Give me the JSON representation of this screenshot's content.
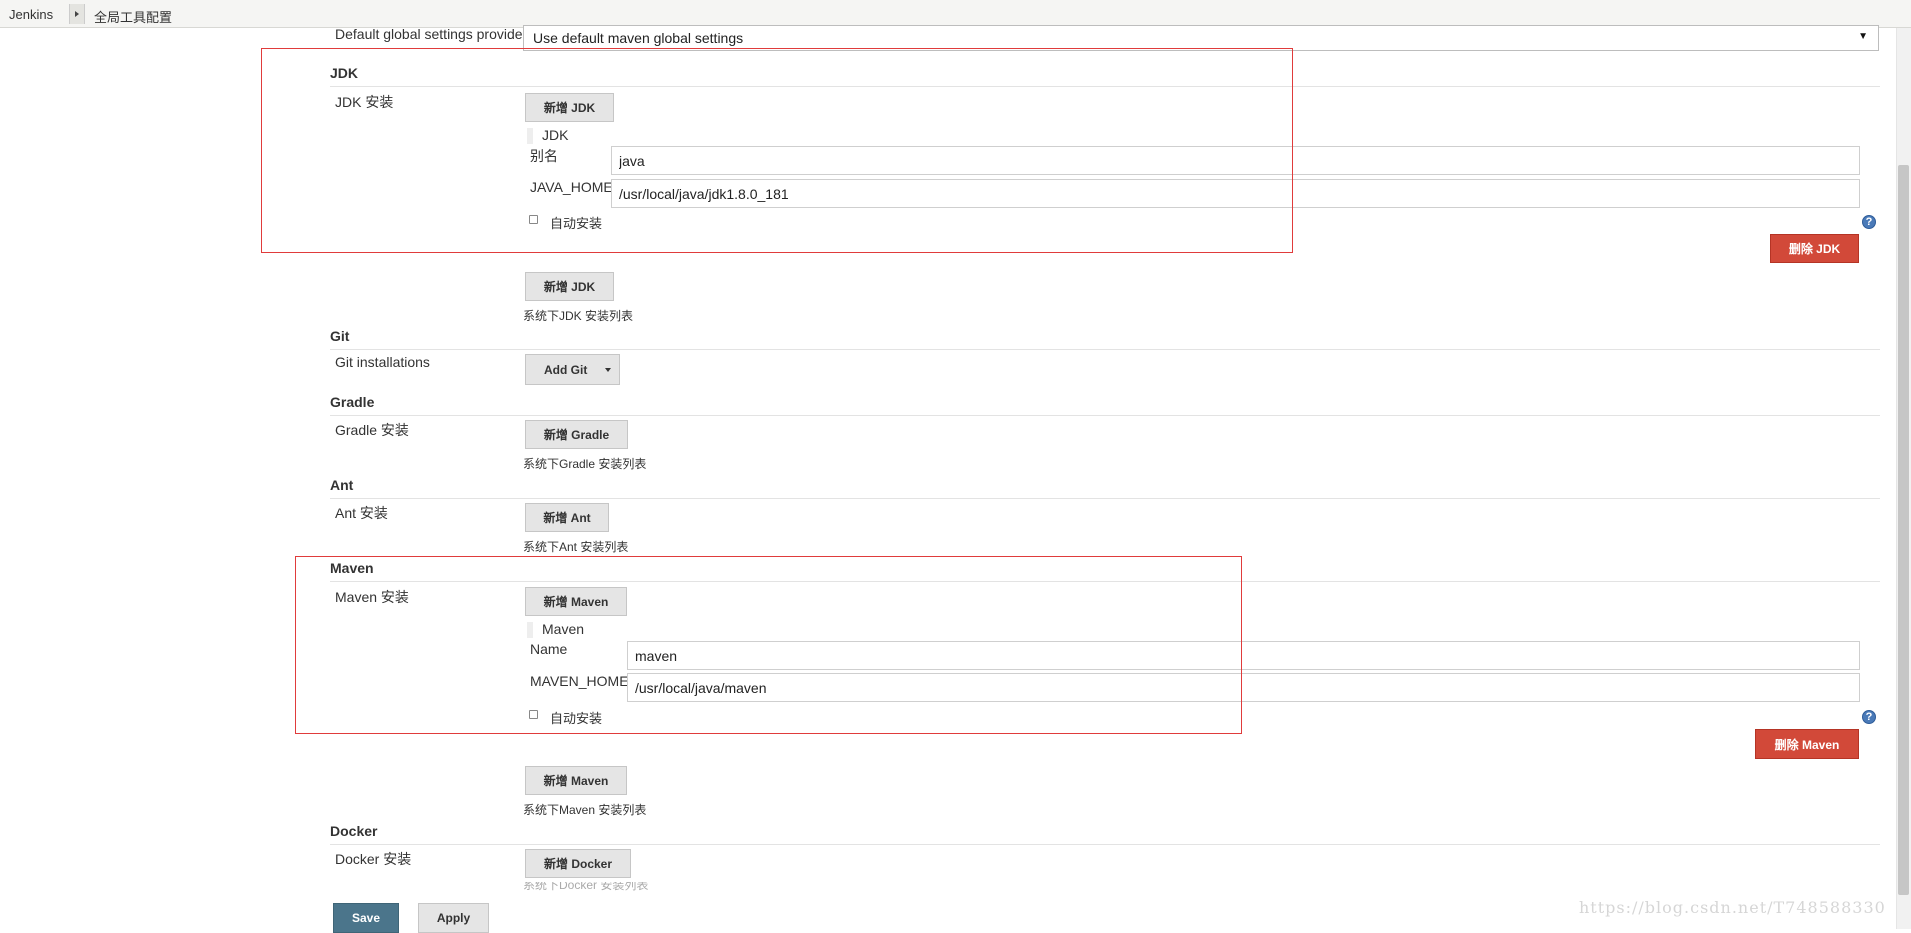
{
  "breadcrumb": {
    "home": "Jenkins",
    "current": "全局工具配置"
  },
  "maven_config": {
    "global_settings_label": "Default global settings provider",
    "global_settings_value": "Use default maven global settings"
  },
  "jdk": {
    "section_title": "JDK",
    "install_label": "JDK 安装",
    "add_button": "新增 JDK",
    "item_title": "JDK",
    "alias_label": "别名",
    "alias_value": "java",
    "home_label": "JAVA_HOME",
    "home_value": "/usr/local/java/jdk1.8.0_181",
    "auto_install_label": "自动安装",
    "delete_button": "删除 JDK",
    "add_button_bottom": "新增 JDK",
    "list_desc": "系统下JDK 安装列表"
  },
  "git": {
    "section_title": "Git",
    "install_label": "Git installations",
    "add_button": "Add Git"
  },
  "gradle": {
    "section_title": "Gradle",
    "install_label": "Gradle 安装",
    "add_button": "新增 Gradle",
    "list_desc": "系统下Gradle 安装列表"
  },
  "ant": {
    "section_title": "Ant",
    "install_label": "Ant 安装",
    "add_button": "新增 Ant",
    "list_desc": "系统下Ant 安装列表"
  },
  "maven": {
    "section_title": "Maven",
    "install_label": "Maven 安装",
    "add_button": "新增 Maven",
    "item_title": "Maven",
    "name_label": "Name",
    "name_value": "maven",
    "home_label": "MAVEN_HOME",
    "home_value": "/usr/local/java/maven",
    "auto_install_label": "自动安装",
    "delete_button": "删除 Maven",
    "add_button_bottom": "新增 Maven",
    "list_desc": "系统下Maven 安装列表"
  },
  "docker": {
    "section_title": "Docker",
    "install_label": "Docker 安装",
    "add_button": "新增 Docker",
    "list_desc": "系统下Docker 安装列表"
  },
  "footer": {
    "save_button": "Save",
    "apply_button": "Apply"
  },
  "icons": {
    "help": "help-icon",
    "breadcrumb_separator": "chevron-right-icon",
    "dropdown": "chevron-down-icon"
  },
  "watermark": "https://blog.csdn.net/T748588330",
  "colors": {
    "delete_button": "#d24939",
    "save_button": "#4b758b",
    "highlight_box": "#e03b3b",
    "help_icon": "#4a7ab8"
  }
}
